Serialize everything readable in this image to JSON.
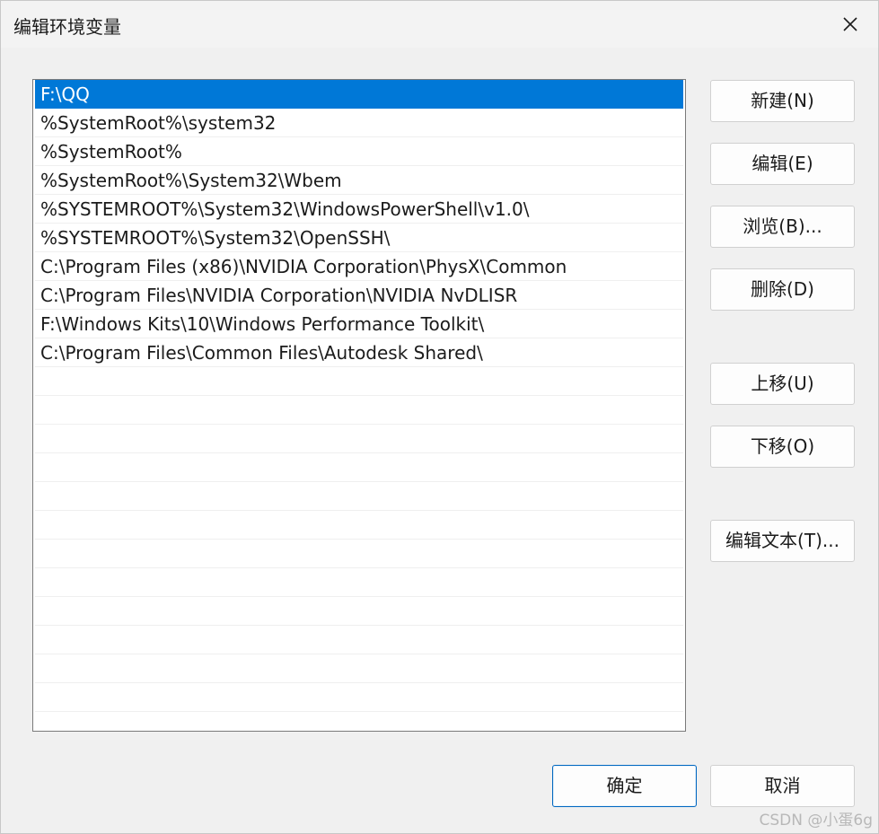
{
  "window": {
    "title": "编辑环境变量",
    "close_icon": "close-icon"
  },
  "path_list": {
    "selected_index": 0,
    "items": [
      "F:\\QQ",
      "%SystemRoot%\\system32",
      "%SystemRoot%",
      "%SystemRoot%\\System32\\Wbem",
      "%SYSTEMROOT%\\System32\\WindowsPowerShell\\v1.0\\",
      "%SYSTEMROOT%\\System32\\OpenSSH\\",
      "C:\\Program Files (x86)\\NVIDIA Corporation\\PhysX\\Common",
      "C:\\Program Files\\NVIDIA Corporation\\NVIDIA NvDLISR",
      "F:\\Windows Kits\\10\\Windows Performance Toolkit\\",
      "C:\\Program Files\\Common Files\\Autodesk Shared\\"
    ],
    "empty_row_count": 12
  },
  "buttons": {
    "new": "新建(N)",
    "edit": "编辑(E)",
    "browse": "浏览(B)...",
    "delete": "删除(D)",
    "move_up": "上移(U)",
    "move_down": "下移(O)",
    "edit_text": "编辑文本(T)...",
    "ok": "确定",
    "cancel": "取消"
  },
  "watermark": "CSDN @小蛋6g",
  "colors": {
    "selection": "#0078d7",
    "primary_border": "#0067c0"
  }
}
